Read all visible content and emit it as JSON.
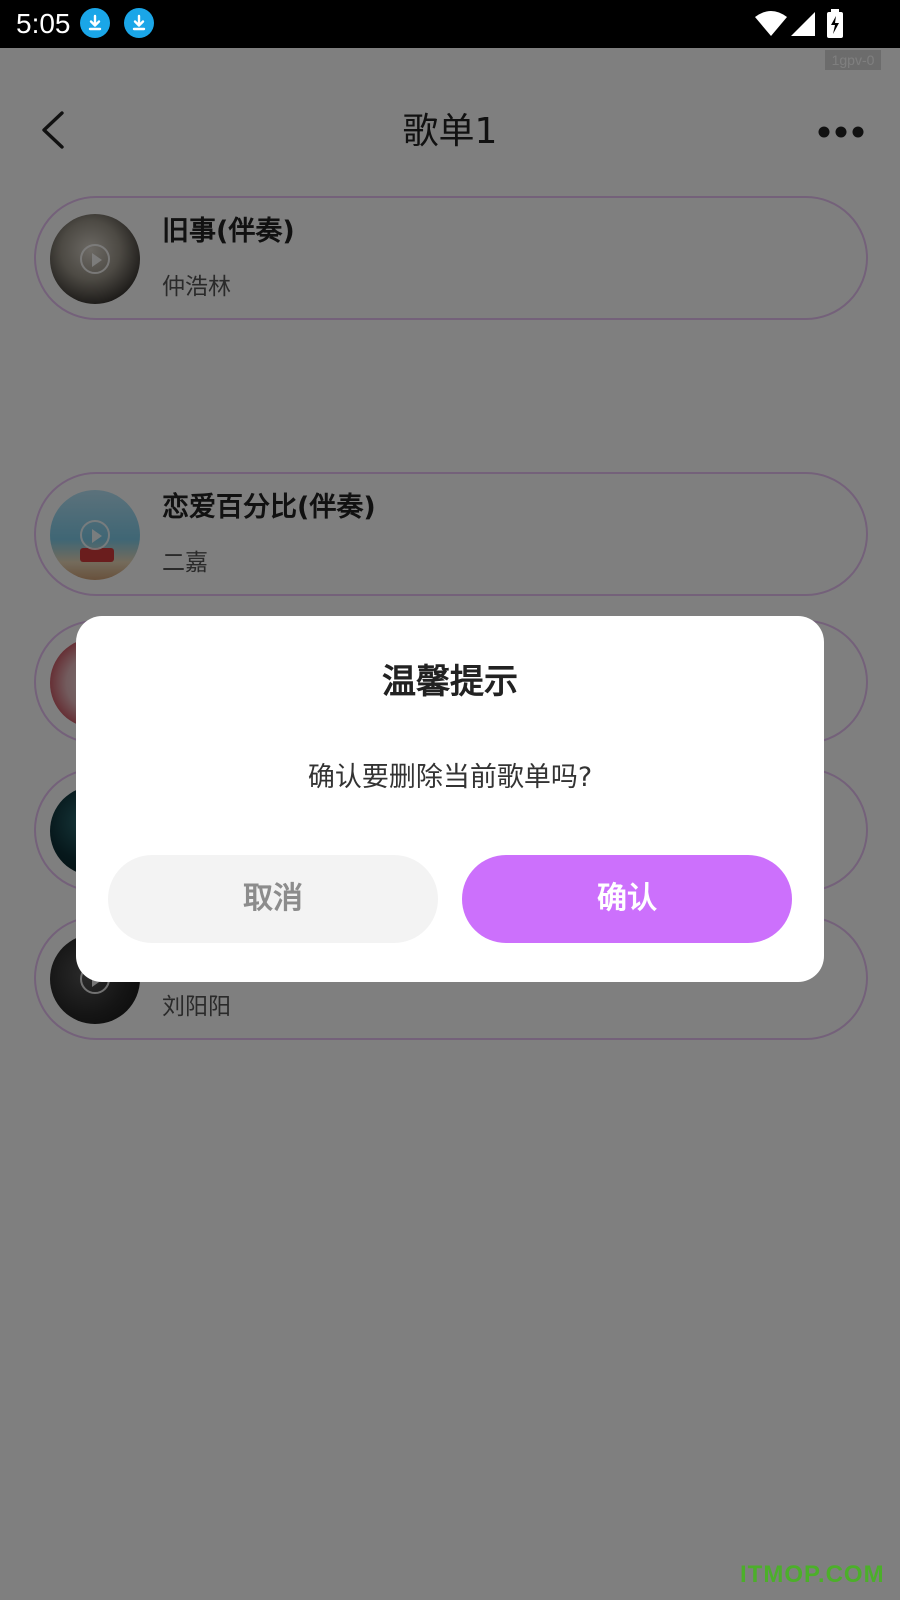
{
  "status_bar": {
    "time": "5:05",
    "icons": [
      "download-icon",
      "download-icon",
      "wifi-icon",
      "signal-icon",
      "battery-charging-icon"
    ]
  },
  "debug_tag": "1gpv-0",
  "header": {
    "title": "歌单1",
    "back_icon": "chevron-left-icon",
    "more_icon": "more-dots-icon"
  },
  "songs": [
    {
      "title": "旧事(伴奏)",
      "artist": "仲浩林"
    },
    {
      "title": "恋爱百分比(伴奏)",
      "artist": "二嘉"
    },
    {
      "title": "",
      "artist": ""
    },
    {
      "title": "",
      "artist": ""
    },
    {
      "title": "",
      "artist": "刘阳阳"
    }
  ],
  "dialog": {
    "title": "温馨提示",
    "message": "确认要删除当前歌单吗?",
    "cancel_label": "取消",
    "confirm_label": "确认"
  },
  "colors": {
    "accent": "#cc70fc",
    "item_border": "#e8c3f4",
    "download_badge": "#1aa6e8",
    "watermark": "#4caf2a"
  },
  "watermark": "ITMOP.COM"
}
